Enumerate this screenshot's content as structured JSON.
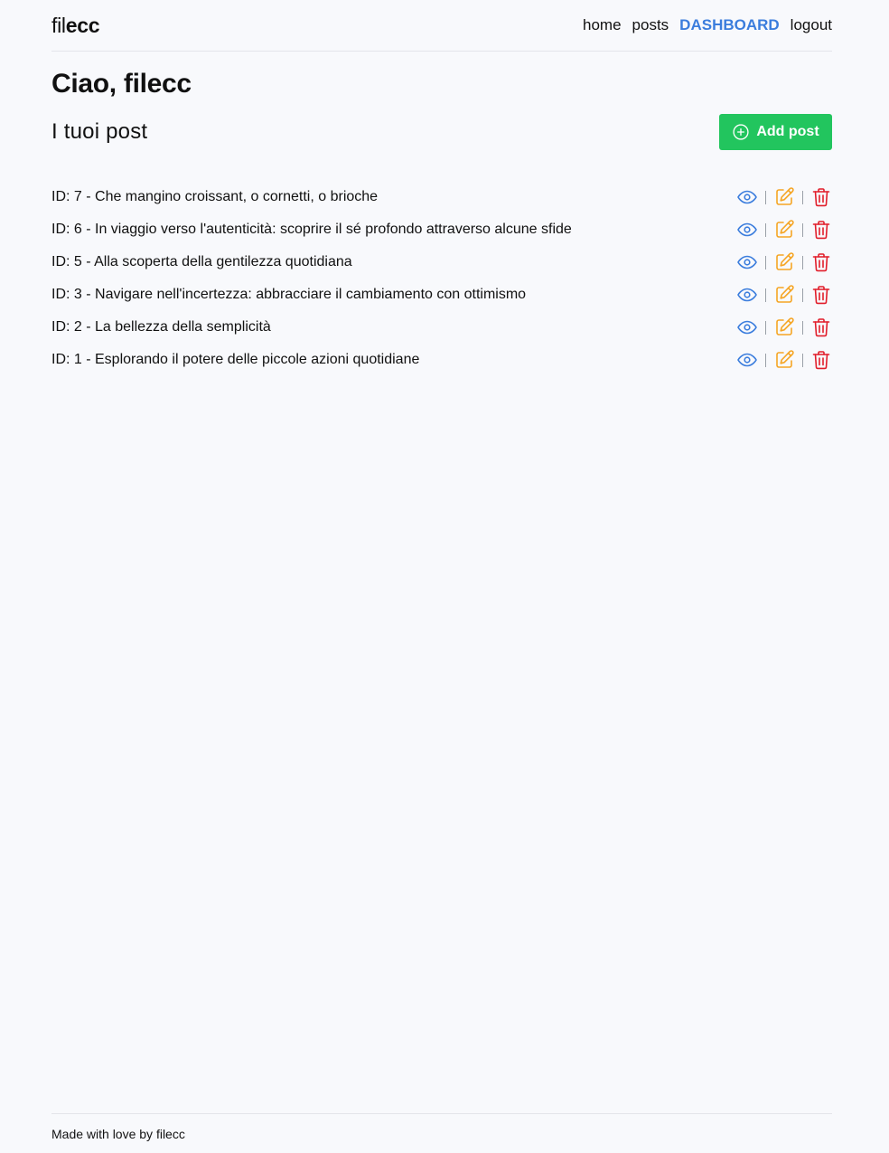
{
  "header": {
    "brand_light": "fil",
    "brand_bold": "ecc",
    "nav": [
      {
        "label": "home"
      },
      {
        "label": "posts"
      },
      {
        "label": "DASHBOARD",
        "active": true
      },
      {
        "label": "logout"
      }
    ]
  },
  "main": {
    "greeting": "Ciao, filecc",
    "section_title": "I tuoi post",
    "add_button_label": "Add post",
    "posts": [
      {
        "id": 7,
        "label": "ID: 7 - Che mangino croissant, o cornetti, o brioche"
      },
      {
        "id": 6,
        "label": "ID: 6 - In viaggio verso l'autenticità: scoprire il sé profondo attraverso alcune sfide"
      },
      {
        "id": 5,
        "label": "ID: 5 - Alla scoperta della gentilezza quotidiana"
      },
      {
        "id": 3,
        "label": "ID: 3 - Navigare nell'incertezza: abbracciare il cambiamento con ottimismo"
      },
      {
        "id": 2,
        "label": "ID: 2 - La bellezza della semplicità"
      },
      {
        "id": 1,
        "label": "ID: 1 - Esplorando il potere delle piccole azioni quotidiane"
      }
    ],
    "action_icons": {
      "view": "eye-icon",
      "edit": "pencil-square-icon",
      "delete": "trash-icon"
    }
  },
  "footer": {
    "text": "Made with love by filecc"
  },
  "colors": {
    "background": "#f8f9fc",
    "accent": "#3b7ddd",
    "add_button": "#22c55e",
    "view_icon": "#3b7ddd",
    "edit_icon": "#f5a524",
    "delete_icon": "#e11d2a"
  }
}
